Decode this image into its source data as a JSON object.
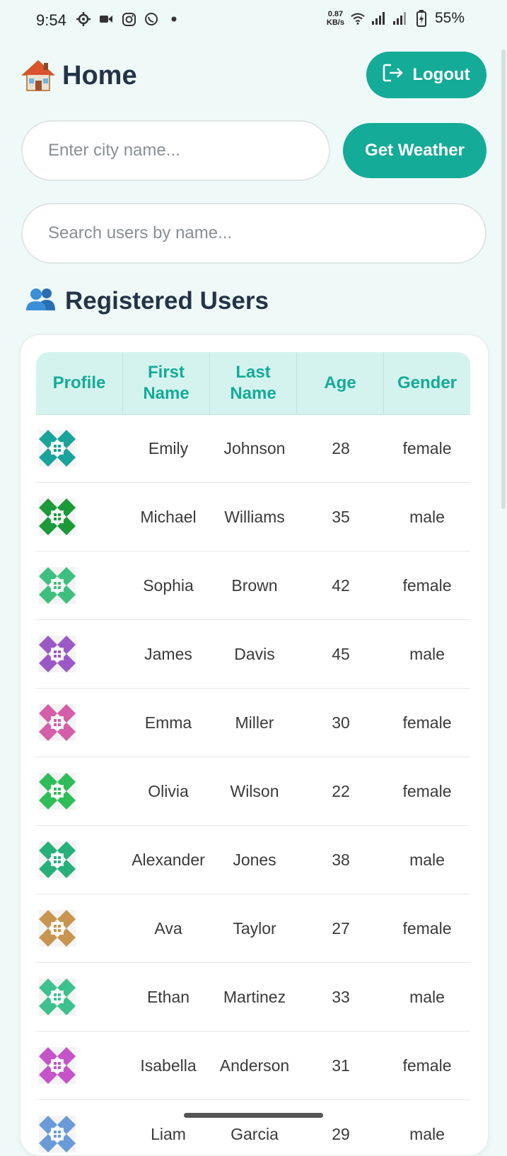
{
  "status_bar": {
    "time": "9:54",
    "net_speed_value": "0.87",
    "net_speed_unit": "KB/s",
    "battery": "55%"
  },
  "header": {
    "title": "Home",
    "logout_label": "Logout"
  },
  "weather": {
    "city_placeholder": "Enter city name...",
    "button_label": "Get Weather"
  },
  "search": {
    "placeholder": "Search users by name..."
  },
  "users_section": {
    "title": "Registered Users",
    "columns": [
      "Profile",
      "First Name",
      "Last Name",
      "Age",
      "Gender"
    ],
    "rows": [
      {
        "first": "Emily",
        "last": "Johnson",
        "age": "28",
        "gender": "female",
        "color": "#1aa39a"
      },
      {
        "first": "Michael",
        "last": "Williams",
        "age": "35",
        "gender": "male",
        "color": "#1c9a3a"
      },
      {
        "first": "Sophia",
        "last": "Brown",
        "age": "42",
        "gender": "female",
        "color": "#3fbf7f"
      },
      {
        "first": "James",
        "last": "Davis",
        "age": "45",
        "gender": "male",
        "color": "#9b59c6"
      },
      {
        "first": "Emma",
        "last": "Miller",
        "age": "30",
        "gender": "female",
        "color": "#d45ea8"
      },
      {
        "first": "Olivia",
        "last": "Wilson",
        "age": "22",
        "gender": "female",
        "color": "#2ebd58"
      },
      {
        "first": "Alexander",
        "last": "Jones",
        "age": "38",
        "gender": "male",
        "color": "#27b07a"
      },
      {
        "first": "Ava",
        "last": "Taylor",
        "age": "27",
        "gender": "female",
        "color": "#c89550"
      },
      {
        "first": "Ethan",
        "last": "Martinez",
        "age": "33",
        "gender": "male",
        "color": "#3ec18e"
      },
      {
        "first": "Isabella",
        "last": "Anderson",
        "age": "31",
        "gender": "female",
        "color": "#c454c8"
      },
      {
        "first": "Liam",
        "last": "Garcia",
        "age": "29",
        "gender": "male",
        "color": "#6a9bd8"
      }
    ]
  },
  "colors": {
    "accent": "#14ab98",
    "background": "#eff9f7",
    "header_fill": "#d4f3ee"
  }
}
